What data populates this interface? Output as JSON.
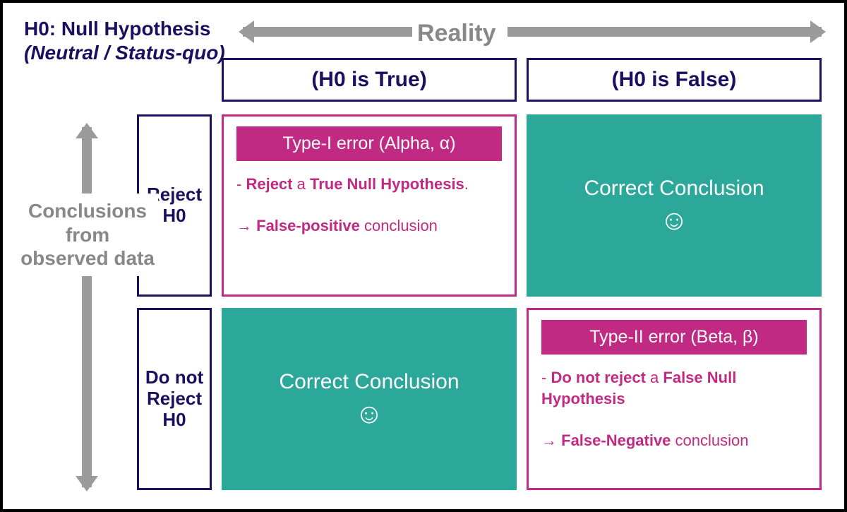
{
  "title": {
    "line1": "H0: Null Hypothesis",
    "line2": "(Neutral / Status-quo)"
  },
  "axes": {
    "top_label": "Reality",
    "left_label": "Conclusions from observed data"
  },
  "columns": {
    "c1": "(H0 is True)",
    "c2": "(H0 is False)"
  },
  "rows": {
    "r1": "Reject H0",
    "r2": "Do not Reject H0"
  },
  "cells": {
    "r1c1": {
      "type": "error",
      "title": "Type-I error (Alpha, α)",
      "desc_prefix": "- ",
      "desc_b1": "Reject",
      "desc_mid": " a ",
      "desc_b2": "True Null Hypothesis",
      "desc_suffix": ".",
      "concl_prefix": "→ ",
      "concl_b": "False-positive",
      "concl_suffix": " conclusion"
    },
    "r1c2": {
      "type": "correct",
      "label": "Correct Conclusion",
      "icon": "☺"
    },
    "r2c1": {
      "type": "correct",
      "label": "Correct Conclusion",
      "icon": "☺"
    },
    "r2c2": {
      "type": "error",
      "title": "Type-II  error (Beta, β)",
      "desc_prefix": "- ",
      "desc_b1": "Do not reject",
      "desc_mid": " a ",
      "desc_b2": "False Null Hypothesis",
      "desc_suffix": "",
      "concl_prefix": "→ ",
      "concl_b": "False-Negative",
      "concl_suffix": " conclusion"
    }
  },
  "colors": {
    "navy": "#1a1060",
    "teal": "#2ba89a",
    "magenta": "#c12a82",
    "grey": "#9b9b9b"
  }
}
